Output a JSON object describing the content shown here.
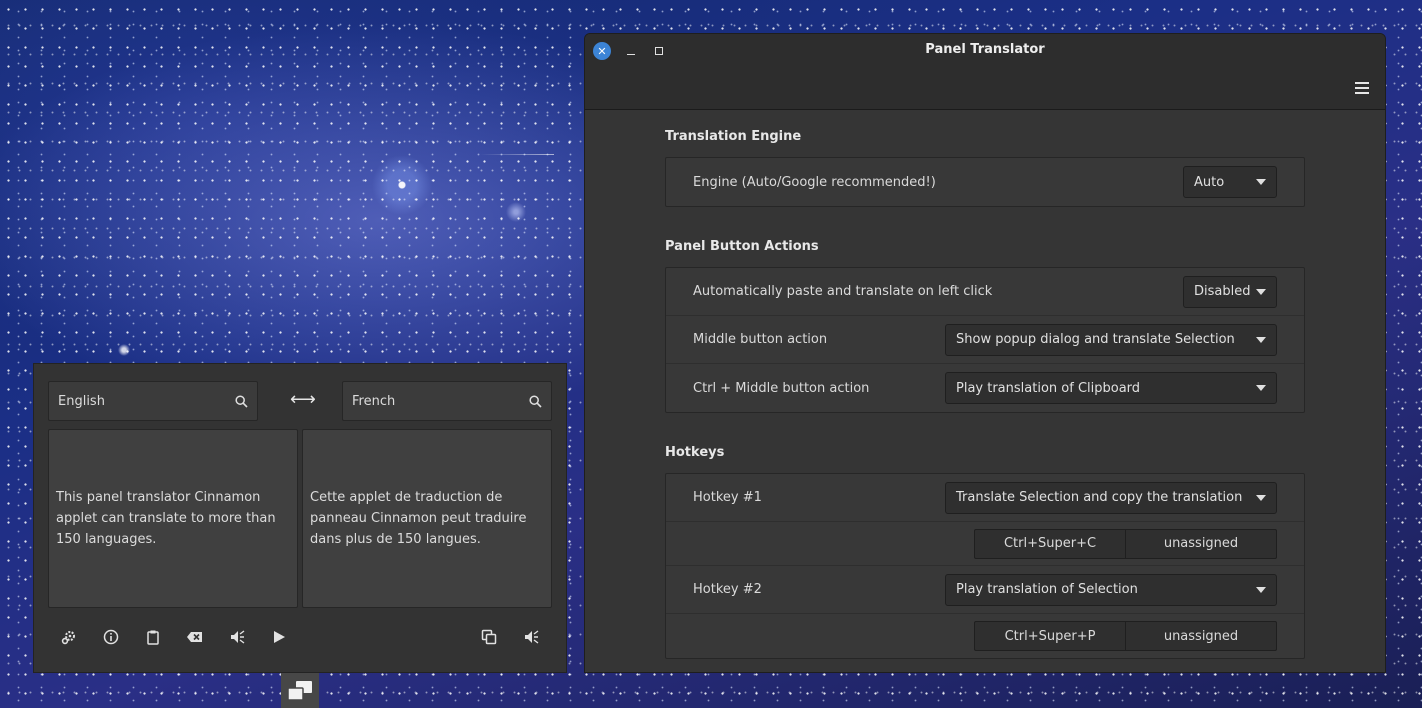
{
  "window": {
    "title": "Panel Translator"
  },
  "sections": {
    "engine": {
      "title": "Translation Engine",
      "rows": [
        {
          "label": "Engine (Auto/Google recommended!)",
          "value": "Auto"
        }
      ]
    },
    "panel_actions": {
      "title": "Panel Button Actions",
      "rows": [
        {
          "label": "Automatically paste and translate on left click",
          "value": "Disabled"
        },
        {
          "label": "Middle button action",
          "value": "Show popup dialog and translate Selection"
        },
        {
          "label": "Ctrl + Middle button action",
          "value": "Play translation of Clipboard"
        }
      ]
    },
    "hotkeys": {
      "title": "Hotkeys",
      "items": [
        {
          "label": "Hotkey #1",
          "value": "Translate Selection and copy the translation",
          "key_primary": "Ctrl+Super+C",
          "key_secondary": "unassigned"
        },
        {
          "label": "Hotkey #2",
          "value": "Play translation of Selection",
          "key_primary": "Ctrl+Super+P",
          "key_secondary": "unassigned"
        }
      ]
    }
  },
  "popup": {
    "source_lang": "English",
    "target_lang": "French",
    "source_text": "This panel translator Cinnamon applet can translate to more than 150 languages.",
    "target_text": "Cette applet de traduction de panneau Cinnamon peut traduire dans plus de 150 langues."
  },
  "icons": {
    "close": "close-icon",
    "minimize": "minimize-icon",
    "maximize": "maximize-icon",
    "menu": "hamburger-menu-icon",
    "search": "search-icon",
    "swap": "swap-arrows-icon",
    "toolbar": [
      "settings-icon",
      "info-icon",
      "clipboard-icon",
      "clear-icon",
      "speak-icon",
      "play-icon",
      "copy-icon",
      "speak-icon"
    ],
    "taskbar": "translator-applet-icon"
  },
  "colors": {
    "accent": "#3c84d6",
    "window_bg": "#353535",
    "titlebar_bg": "#2d2d2d"
  }
}
